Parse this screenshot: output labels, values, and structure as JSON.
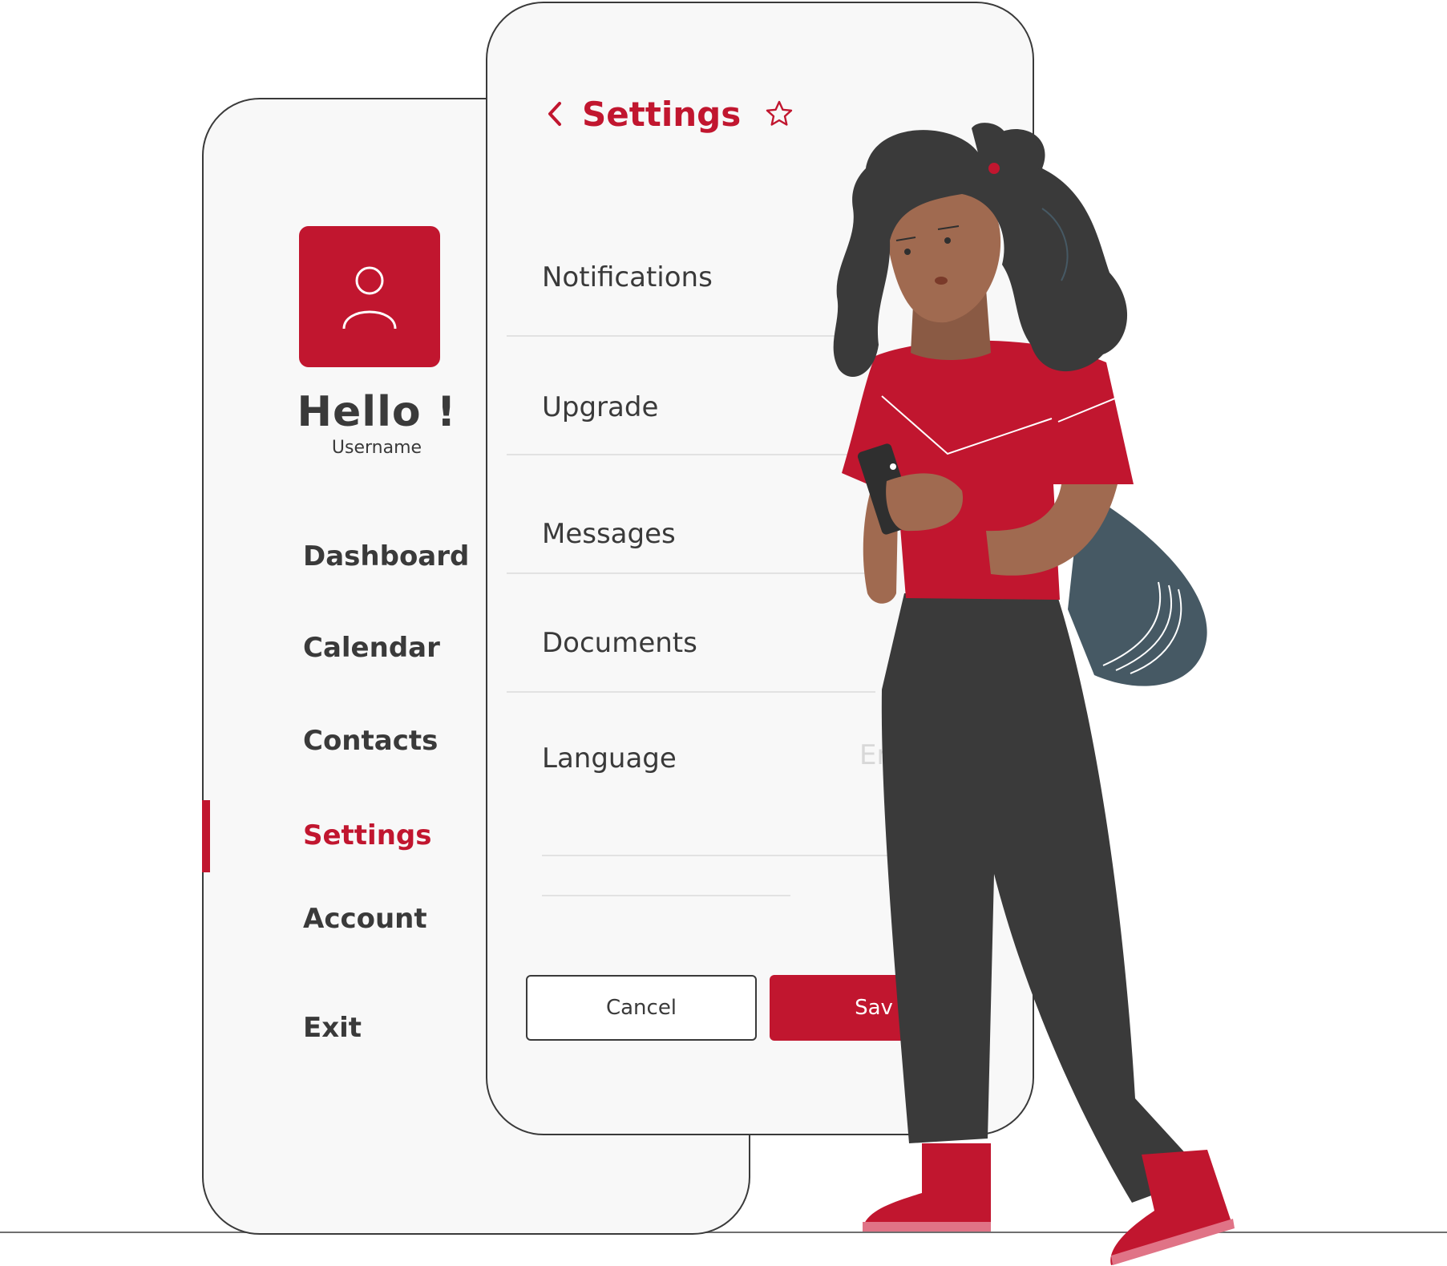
{
  "colors": {
    "accent": "#c1162f",
    "text": "#3a3a3a",
    "panel": "#f8f8f8"
  },
  "sidebar": {
    "greeting": "Hello !",
    "username": "Username",
    "avatar_icon": "user-icon",
    "items": [
      {
        "label": "Dashboard",
        "active": false
      },
      {
        "label": "Calendar",
        "active": false
      },
      {
        "label": "Contacts",
        "active": false
      },
      {
        "label": "Settings",
        "active": true
      },
      {
        "label": "Account",
        "active": false
      },
      {
        "label": "Exit",
        "active": false
      }
    ]
  },
  "settings": {
    "title": "Settings",
    "back_icon": "chevron-left-icon",
    "favorite_icon": "star-icon",
    "rows": [
      {
        "label": "Notifications"
      },
      {
        "label": "Upgrade"
      },
      {
        "label": "Messages"
      },
      {
        "label": "Documents"
      },
      {
        "label": "Language",
        "value": "En"
      }
    ],
    "cancel_label": "Cancel",
    "save_label": "Sav"
  }
}
